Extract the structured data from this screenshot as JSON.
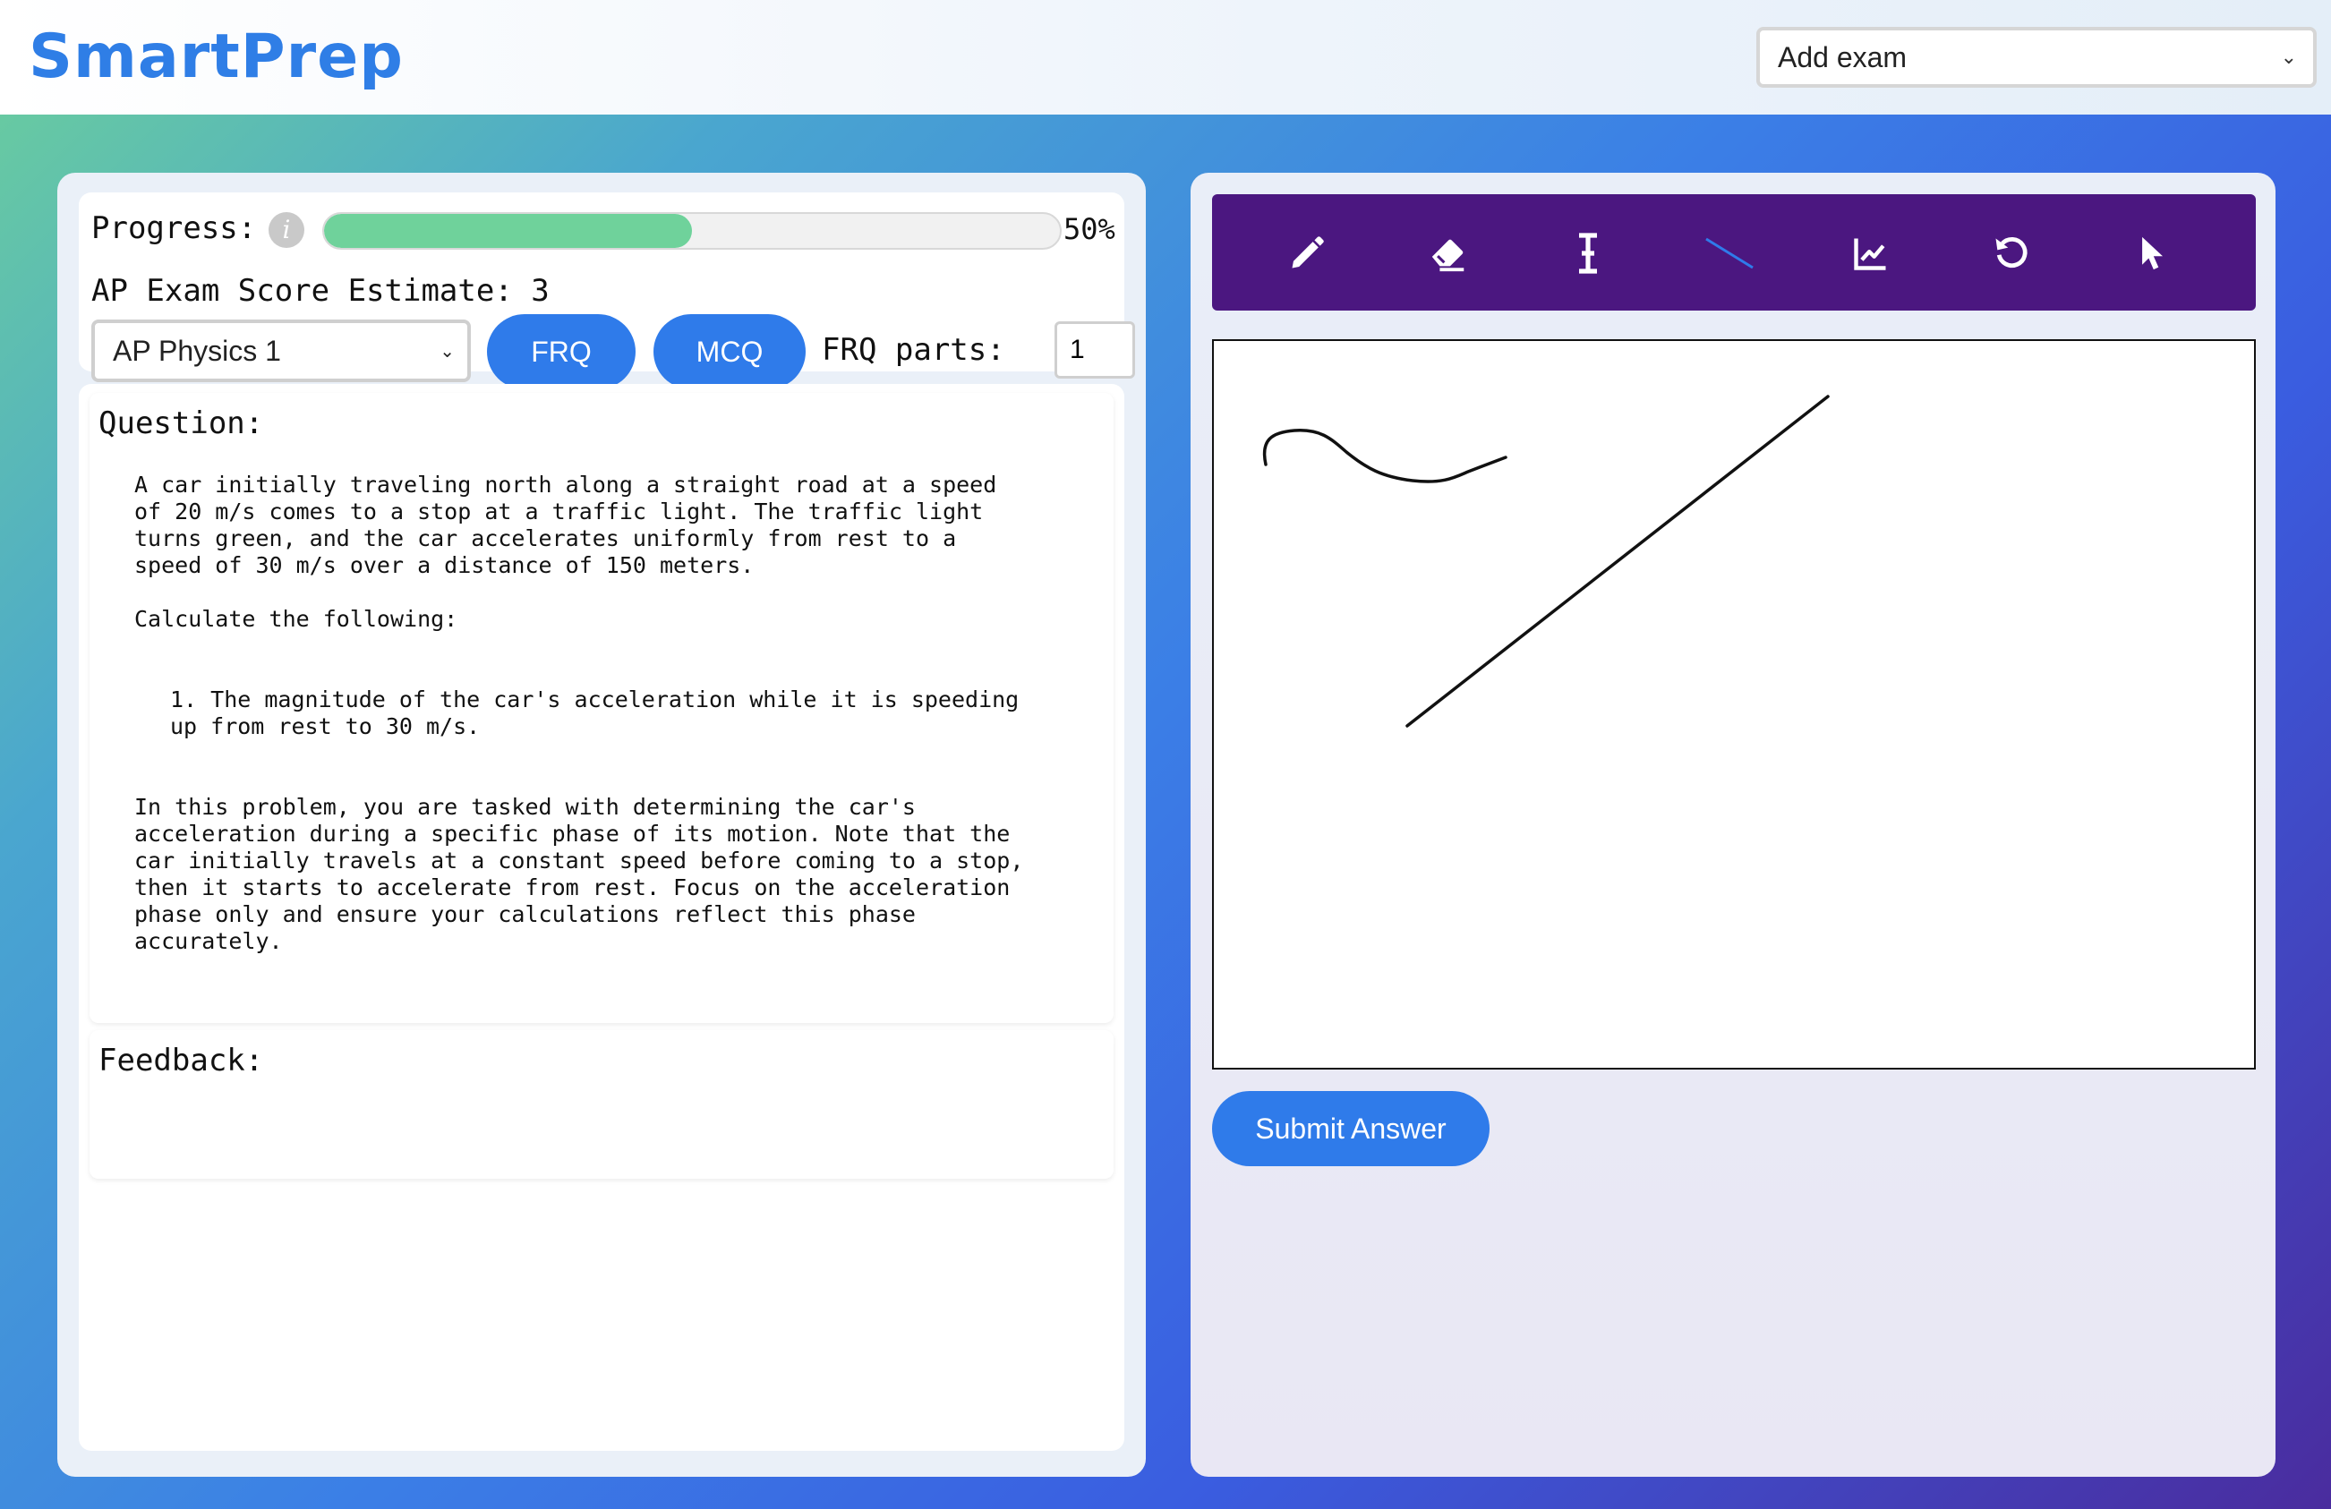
{
  "header": {
    "logo_text": "SmartPrep",
    "exam_select_value": "Add exam"
  },
  "stats": {
    "progress_label": "Progress:",
    "info_icon": "info-icon",
    "progress_fraction": 0.5,
    "progress_text": "50%",
    "score_label": "AP Exam Score Estimate: 3",
    "subject_select_value": "AP Physics 1",
    "frq_button": "FRQ",
    "mcq_button": "MCQ",
    "frq_parts_label": "FRQ parts:",
    "frq_parts_value": "1"
  },
  "question": {
    "title": "Question:",
    "intro": "A car initially traveling north along a straight road at a speed\nof 20 m/s comes to a stop at a traffic light. The traffic light\nturns green, and the car accelerates uniformly from rest to a\nspeed of 30 m/s over a distance of 150 meters.",
    "prompt": "Calculate the following:",
    "item_1": "1. The magnitude of the car's acceleration while it is speeding\nup from rest to 30 m/s.",
    "note": "In this problem, you are tasked with determining the car's\nacceleration during a specific phase of its motion. Note that the\ncar initially travels at a constant speed before coming to a stop,\nthen it starts to accelerate from rest. Focus on the acceleration\nphase only and ensure your calculations reflect this phase\naccurately."
  },
  "feedback": {
    "title": "Feedback:"
  },
  "toolbar": {
    "tools": [
      "pencil-icon",
      "eraser-icon",
      "text-cursor-icon",
      "line-icon",
      "graph-icon",
      "undo-icon",
      "pointer-icon"
    ],
    "active_tool": "line-icon",
    "background": "#4b1780",
    "active_color": "#2f7bea"
  },
  "actions": {
    "submit_label": "Submit Answer"
  },
  "colors": {
    "accent": "#2f7bea",
    "progress_fill": "#6fd29b",
    "logo": "#2f7ee6"
  }
}
